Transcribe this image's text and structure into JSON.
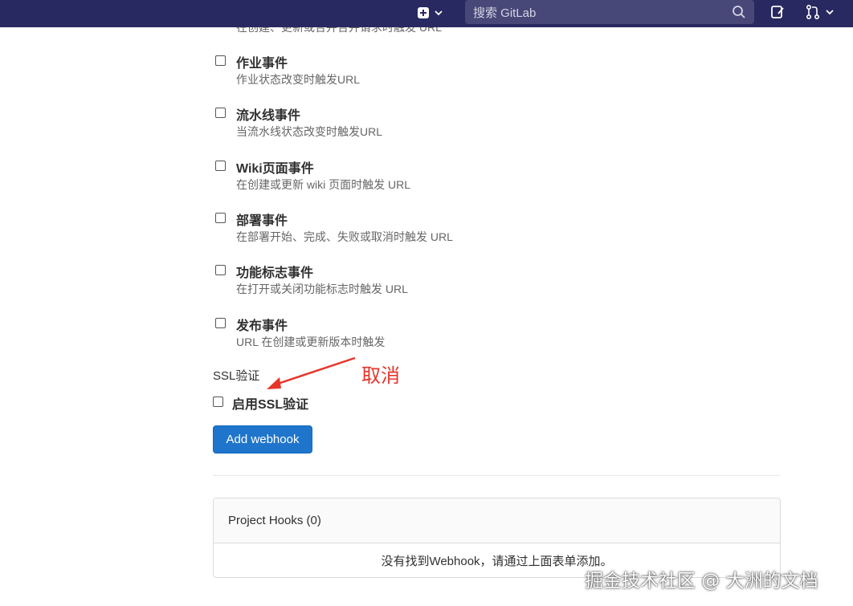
{
  "topbar": {
    "search_placeholder": "搜索 GitLab",
    "icons": [
      "plus-square-icon",
      "chevron-down-icon",
      "search-icon",
      "todo-icon",
      "merge-request-icon",
      "chevron-down-icon"
    ]
  },
  "clipped_description": "在创建、更新或合并合并请求时触发 URL",
  "events": [
    {
      "title": "作业事件",
      "description": "作业状态改变时触发URL"
    },
    {
      "title": "流水线事件",
      "description": "当流水线状态改变时触发URL"
    },
    {
      "title": "Wiki页面事件",
      "description": "在创建或更新 wiki 页面时触发 URL"
    },
    {
      "title": "部署事件",
      "description": "在部署开始、完成、失败或取消时触发 URL"
    },
    {
      "title": "功能标志事件",
      "description": "在打开或关闭功能标志时触发 URL"
    },
    {
      "title": "发布事件",
      "description": "URL 在创建或更新版本时触发"
    }
  ],
  "ssl": {
    "heading": "SSL验证",
    "checkbox_label": "启用SSL验证",
    "checked": false
  },
  "annotation": {
    "text": "取消",
    "color": "#e5352b"
  },
  "add_webhook_label": "Add webhook",
  "project_hooks": {
    "title": "Project Hooks (0)",
    "empty_message": "没有找到Webhook，请通过上面表单添加。"
  },
  "watermark": "掘金技术社区 @ 大洲的文档",
  "colors": {
    "topbar": "#292961",
    "primary_button": "#1f75cb",
    "annotation": "#e5352b"
  }
}
